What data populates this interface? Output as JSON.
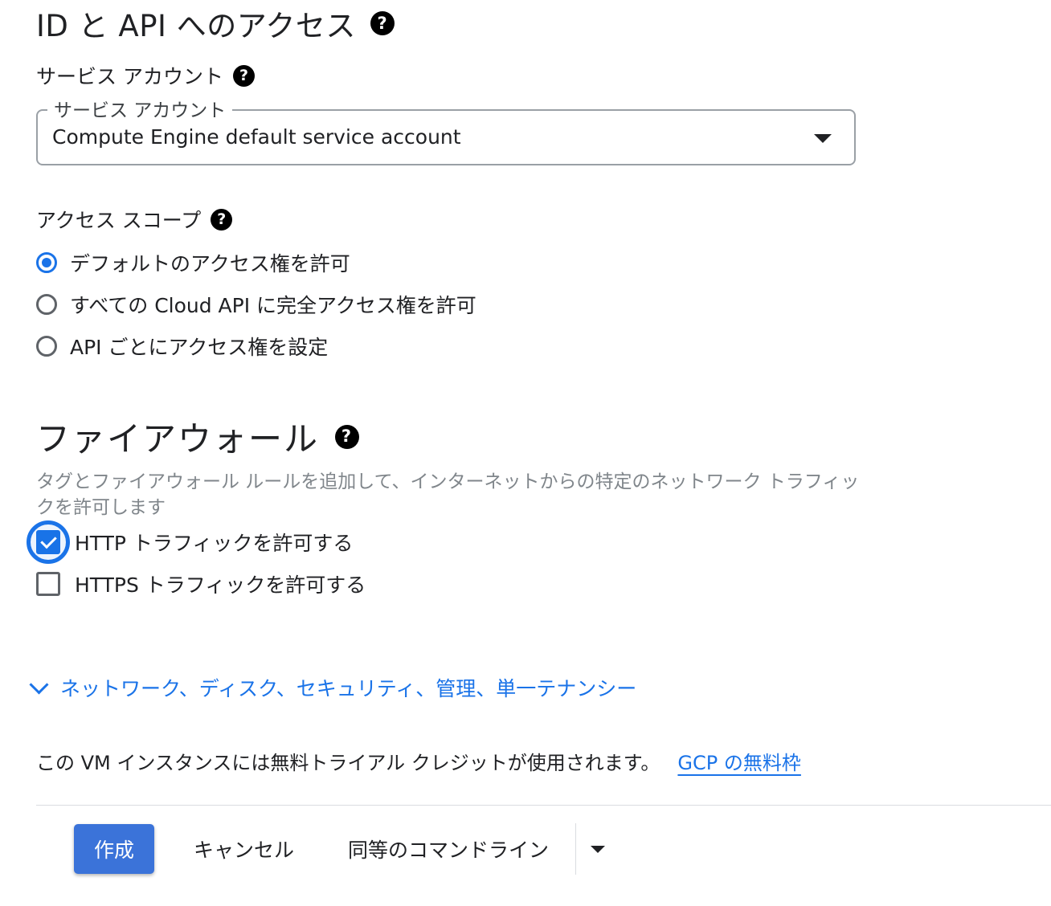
{
  "identity": {
    "heading": "ID と API へのアクセス",
    "help_icon": "?",
    "service_account_label": "サービス アカウント",
    "service_account_select": {
      "legend": "サービス アカウント",
      "value": "Compute Engine default service account"
    }
  },
  "access_scope": {
    "label": "アクセス スコープ",
    "selected_index": 0,
    "options": [
      "デフォルトのアクセス権を許可",
      "すべての Cloud API に完全アクセス権を許可",
      "API ごとにアクセス権を設定"
    ]
  },
  "firewall": {
    "heading": "ファイアウォール",
    "description": "タグとファイアウォール ルールを追加して、インターネットからの特定のネットワーク トラフィックを許可します",
    "http_label": "HTTP トラフィックを許可する",
    "http_checked": true,
    "https_label": "HTTPS トラフィックを許可する",
    "https_checked": false
  },
  "advanced": {
    "link_label": "ネットワーク、ディスク、セキュリティ、管理、単一テナンシー"
  },
  "trial": {
    "note": "この VM インスタンスには無料トライアル クレジットが使用されます。",
    "link": "GCP の無料枠"
  },
  "actions": {
    "create": "作成",
    "cancel": "キャンセル",
    "command_line": "同等のコマンドライン"
  },
  "colors": {
    "accent": "#1a73e8",
    "primary_button": "#3b73d9",
    "muted_text": "#80868b"
  }
}
